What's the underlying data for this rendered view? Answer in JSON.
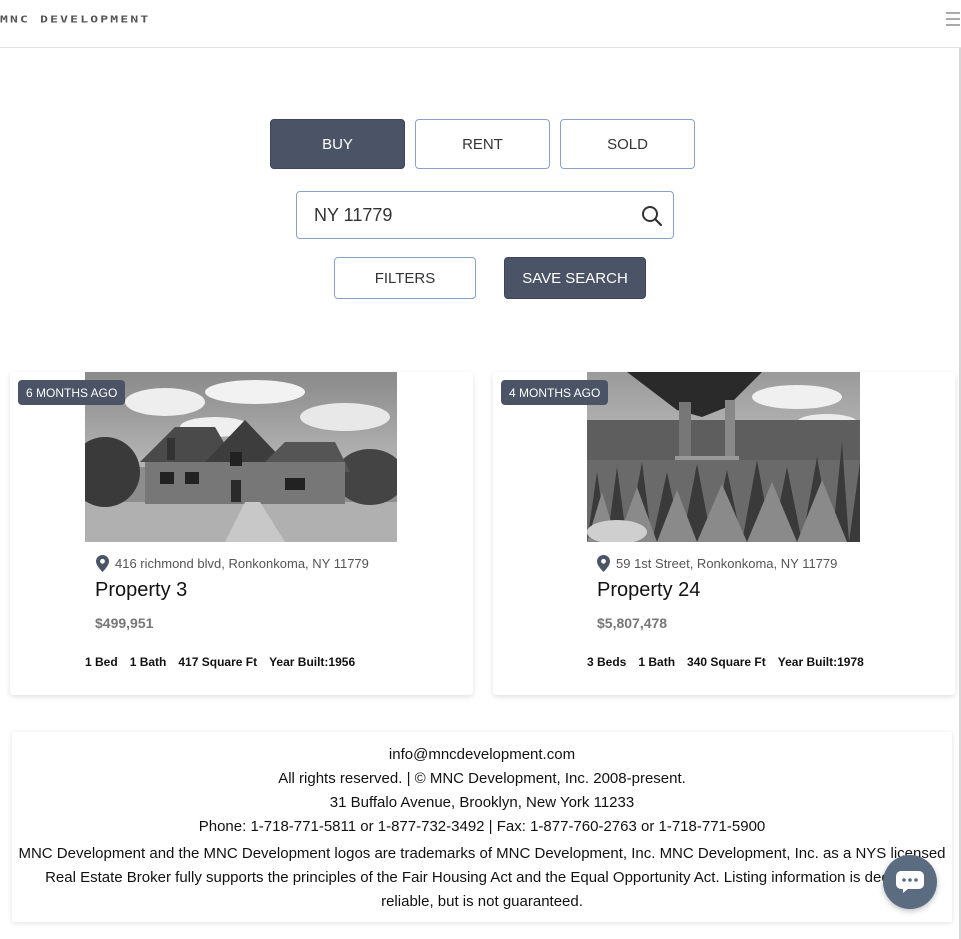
{
  "header": {
    "logo_text": "MNC DEVELOPMENT",
    "menu_icon": "hamburger-menu-icon"
  },
  "search": {
    "tabs": [
      {
        "label": "BUY",
        "active": true
      },
      {
        "label": "RENT",
        "active": false
      },
      {
        "label": "SOLD",
        "active": false
      }
    ],
    "query": "NY 11779",
    "search_icon": "search-icon",
    "filters_label": "FILTERS",
    "save_label": "SAVE SEARCH"
  },
  "listings": [
    {
      "age": "6 MONTHS AGO",
      "address": "416 richmond blvd, Ronkonkoma, NY 11779",
      "title": "Property 3",
      "price": "$499,951",
      "beds": "1 Bed",
      "baths": "1 Bath",
      "sqft": "417 Square Ft",
      "year": "Year Built:1956"
    },
    {
      "age": "4 MONTHS AGO",
      "address": "59 1st Street, Ronkonkoma, NY 11779",
      "title": "Property 24",
      "price": "$5,807,478",
      "beds": "3 Beds",
      "baths": "1 Bath",
      "sqft": "340 Square Ft",
      "year": "Year Built:1978"
    }
  ],
  "footer": {
    "email": "info@mncdevelopment.com",
    "rights": "All rights reserved.  |  © MNC Development, Inc. 2008-present.",
    "address": "31 Buffalo Avenue, Brooklyn, New York 11233",
    "phone": "Phone: 1-718-771-5811 or 1-877-732-3492  |  Fax: 1-877-760-2763 or 1-718-771-5900",
    "legal": "MNC Development and the MNC Development logos are trademarks of MNC Development, Inc. MNC Development, Inc. as a NYS licensed Real Estate Broker fully supports the principles of the Fair Housing Act and the Equal Opportunity Act. Listing information is deemed reliable, but is not guaranteed."
  },
  "chat": {
    "icon": "chat-bubble-icon"
  },
  "colors": {
    "accent": "#4a5466",
    "border": "#8aa2c8",
    "chat": "#5b6b80"
  }
}
